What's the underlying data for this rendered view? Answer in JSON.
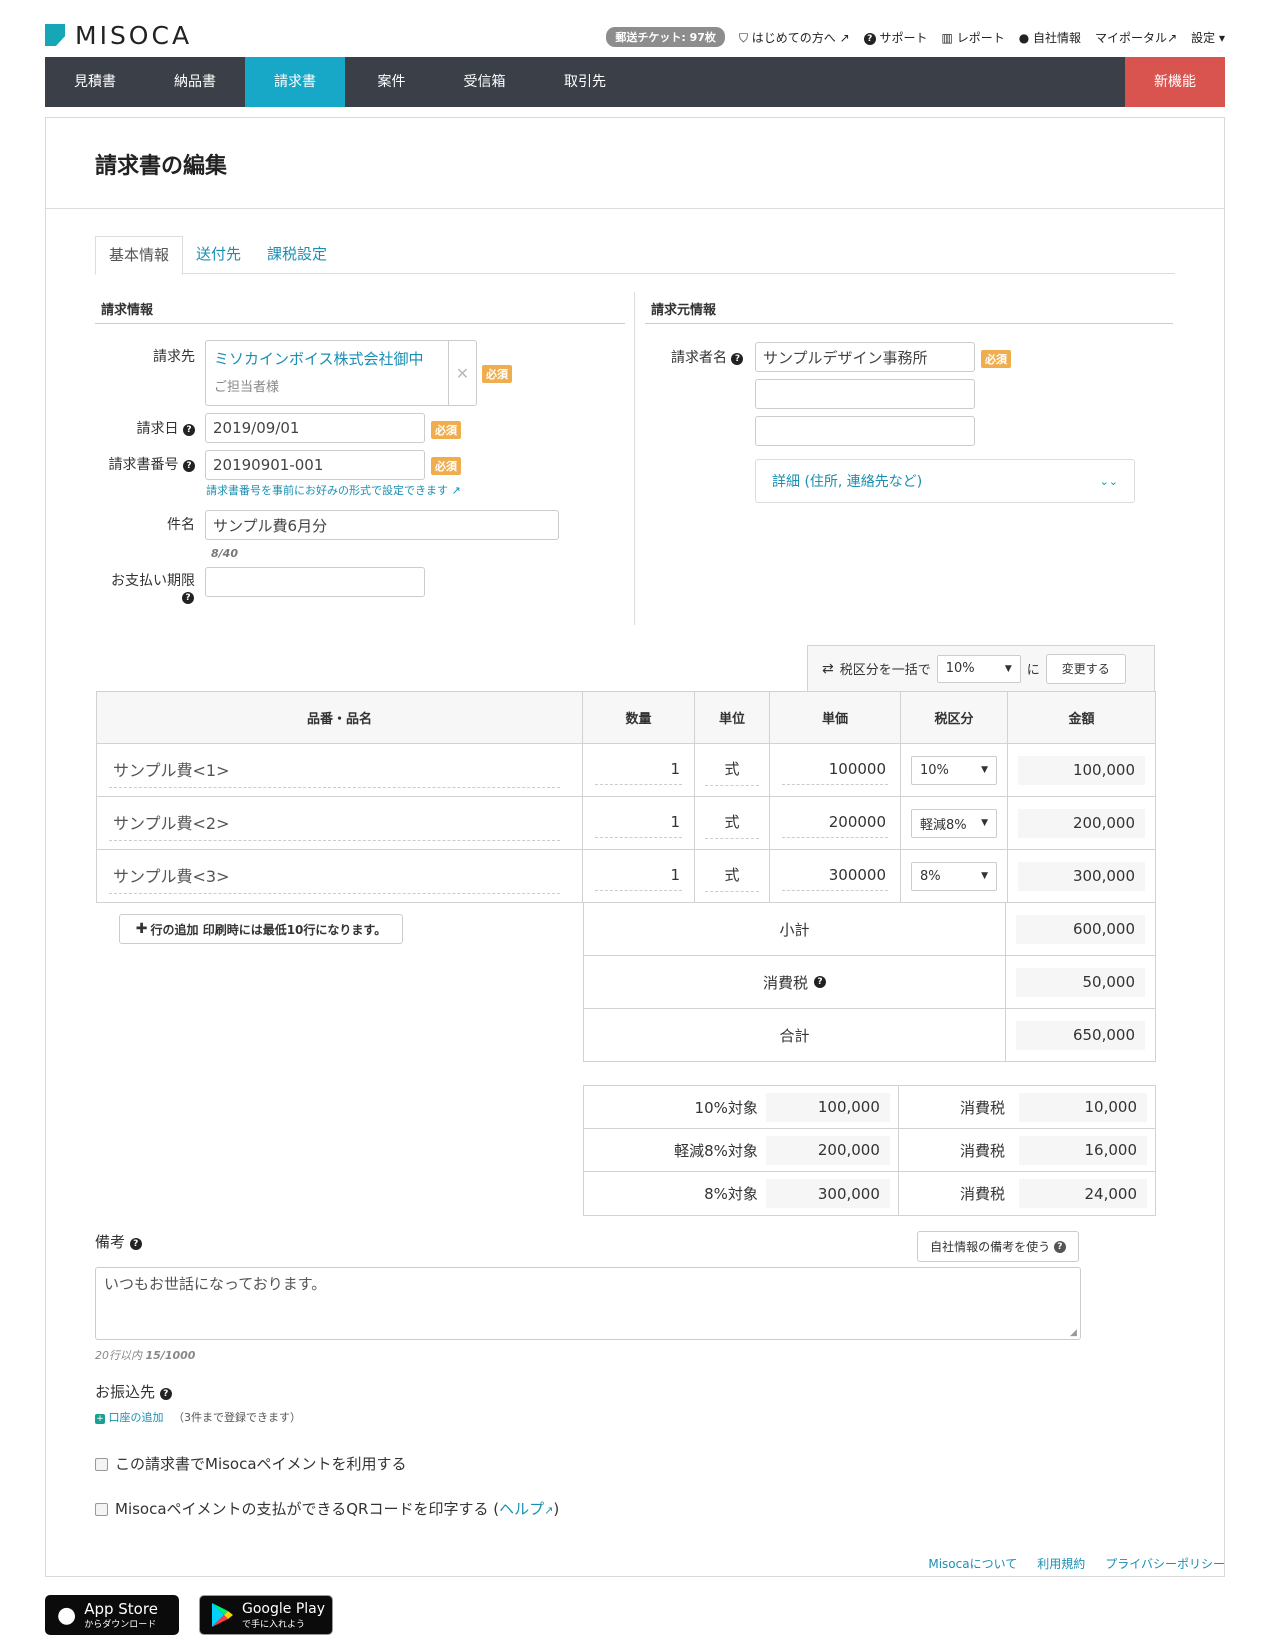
{
  "brand": {
    "name": "MISOCA"
  },
  "top_links": {
    "ticket": "郵送チケット: 97枚",
    "beginner": "はじめての方へ",
    "support": "サポート",
    "report": "レポート",
    "company": "自社情報",
    "portal": "マイポータル",
    "settings": "設定"
  },
  "nav": {
    "items": [
      "見積書",
      "納品書",
      "請求書",
      "案件",
      "受信箱",
      "取引先"
    ],
    "new_feature": "新機能"
  },
  "page_title": "請求書の編集",
  "tabs": [
    "基本情報",
    "送付先",
    "課税設定"
  ],
  "invoice_info": {
    "heading": "請求情報",
    "client_label": "請求先",
    "client_name": "ミソカインボイス株式会社御中",
    "client_contact": "ご担当者様",
    "date_label": "請求日",
    "date_value": "2019/09/01",
    "number_label": "請求書番号",
    "number_value": "20190901-001",
    "number_hint": "請求書番号を事前にお好みの形式で設定できます",
    "subject_label": "件名",
    "subject_value": "サンプル費6月分",
    "subject_count": "8/40",
    "due_label": "お支払い期限",
    "due_value": "",
    "required": "必須"
  },
  "issuer_info": {
    "heading": "請求元情報",
    "name_label": "請求者名",
    "name_value": "サンプルデザイン事務所",
    "line2": "",
    "line3": "",
    "details": "詳細 (住所, 連絡先など)"
  },
  "bulk_tax": {
    "label": "税区分を一括で",
    "value": "10%",
    "suffix": "に",
    "button": "変更する"
  },
  "table": {
    "headers": [
      "品番・品名",
      "数量",
      "単位",
      "単価",
      "税区分",
      "金額"
    ],
    "rows": [
      {
        "name": "サンプル費<1>",
        "qty": "1",
        "unit": "式",
        "price": "100000",
        "tax": "10%",
        "amount": "100,000"
      },
      {
        "name": "サンプル費<2>",
        "qty": "1",
        "unit": "式",
        "price": "200000",
        "tax": "軽減8%",
        "amount": "200,000"
      },
      {
        "name": "サンプル費<3>",
        "qty": "1",
        "unit": "式",
        "price": "300000",
        "tax": "8%",
        "amount": "300,000"
      }
    ],
    "add_row": "行の追加 印刷時には最低10行になります。"
  },
  "totals": {
    "subtotal_label": "小計",
    "subtotal": "600,000",
    "tax_label": "消費税",
    "tax": "50,000",
    "total_label": "合計",
    "total": "650,000"
  },
  "tax_breakdown": [
    {
      "label": "10%対象",
      "base": "100,000",
      "tax_label": "消費税",
      "tax": "10,000"
    },
    {
      "label": "軽減8%対象",
      "base": "200,000",
      "tax_label": "消費税",
      "tax": "16,000"
    },
    {
      "label": "8%対象",
      "base": "300,000",
      "tax_label": "消費税",
      "tax": "24,000"
    }
  ],
  "remarks": {
    "label": "備考",
    "use_company_button": "自社情報の備考を使う",
    "value": "いつもお世話になっております。",
    "limit": "20行以内",
    "count": "15/1000"
  },
  "bank": {
    "label": "お振込先",
    "add": "口座の追加",
    "note": "（3件まで登録できます）"
  },
  "options": {
    "use_payment": "この請求書でMisocaペイメントを利用する",
    "qr_prefix": "Misocaペイメントの支払ができるQRコードを印字する (",
    "qr_help": "ヘルプ",
    "qr_suffix": ")"
  },
  "footer": {
    "app_store_top": "App Store",
    "app_store_sub": "からダウンロード",
    "google_top": "Google Play",
    "google_sub": "で手に入れよう",
    "about": "Misocaについて",
    "terms": "利用規約",
    "privacy": "プライバシーポリシー"
  }
}
